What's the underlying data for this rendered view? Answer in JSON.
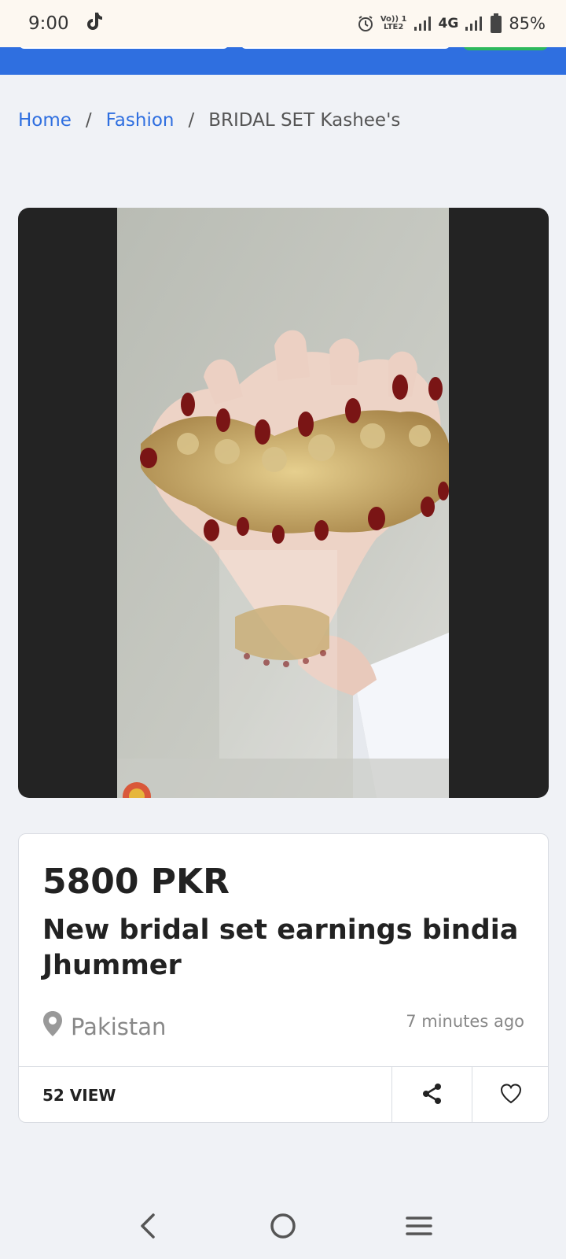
{
  "status_bar": {
    "time": "9:00",
    "network_label_top": "Vo)) 1",
    "network_label_bottom": "LTE2",
    "network_type": "4G",
    "battery": "85%"
  },
  "breadcrumb": {
    "items": [
      {
        "label": "Home"
      },
      {
        "label": "Fashion"
      }
    ],
    "separator": "/",
    "current": "BRIDAL SET Kashee's"
  },
  "listing": {
    "price": "5800 PKR",
    "title": "New bridal set earnings bindia Jhummer",
    "location": "Pakistan",
    "posted": "7 minutes ago",
    "views": "52 VIEW"
  },
  "colors": {
    "primary": "#2f6fe0",
    "accent_green": "#2eb85c",
    "background": "#f0f2f6",
    "gallery_bg": "#232323"
  },
  "icons": {
    "status_app": "tiktok-icon",
    "location": "map-pin-icon",
    "share": "share-icon",
    "favorite": "heart-icon",
    "nav_back": "back-icon",
    "nav_home": "home-circle-icon",
    "nav_menu": "menu-icon"
  }
}
